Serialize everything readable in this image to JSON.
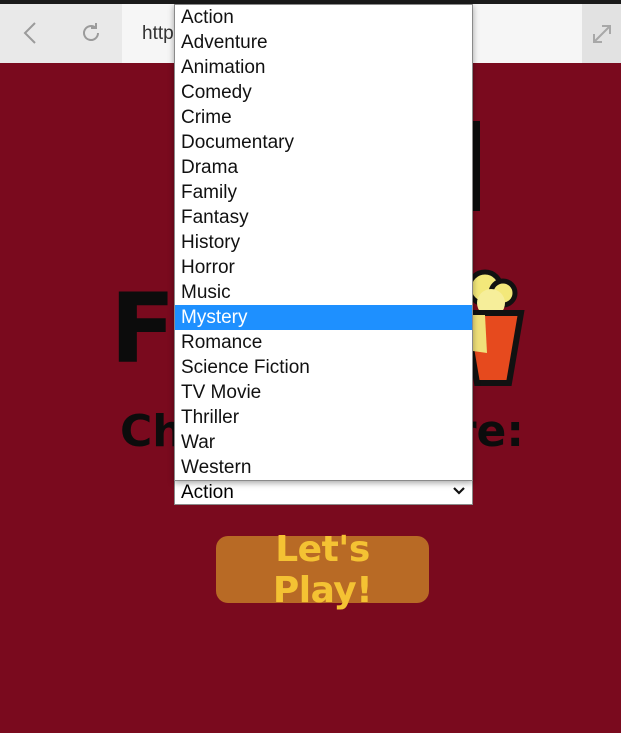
{
  "browser": {
    "url_partial": "http"
  },
  "page": {
    "logo_left_text": "FI",
    "heading_left": "Ch",
    "heading_right": "re:",
    "genre_select_value": "Action",
    "play_button_label": "Let's Play!"
  },
  "dropdown": {
    "options": [
      "Action",
      "Adventure",
      "Animation",
      "Comedy",
      "Crime",
      "Documentary",
      "Drama",
      "Family",
      "Fantasy",
      "History",
      "Horror",
      "Music",
      "Mystery",
      "Romance",
      "Science Fiction",
      "TV Movie",
      "Thriller",
      "War",
      "Western"
    ],
    "highlighted": "Mystery"
  },
  "colors": {
    "page_background": "#7a0a1e",
    "button_background": "#b86a25",
    "button_text": "#f4c233",
    "highlight": "#1e90ff"
  }
}
